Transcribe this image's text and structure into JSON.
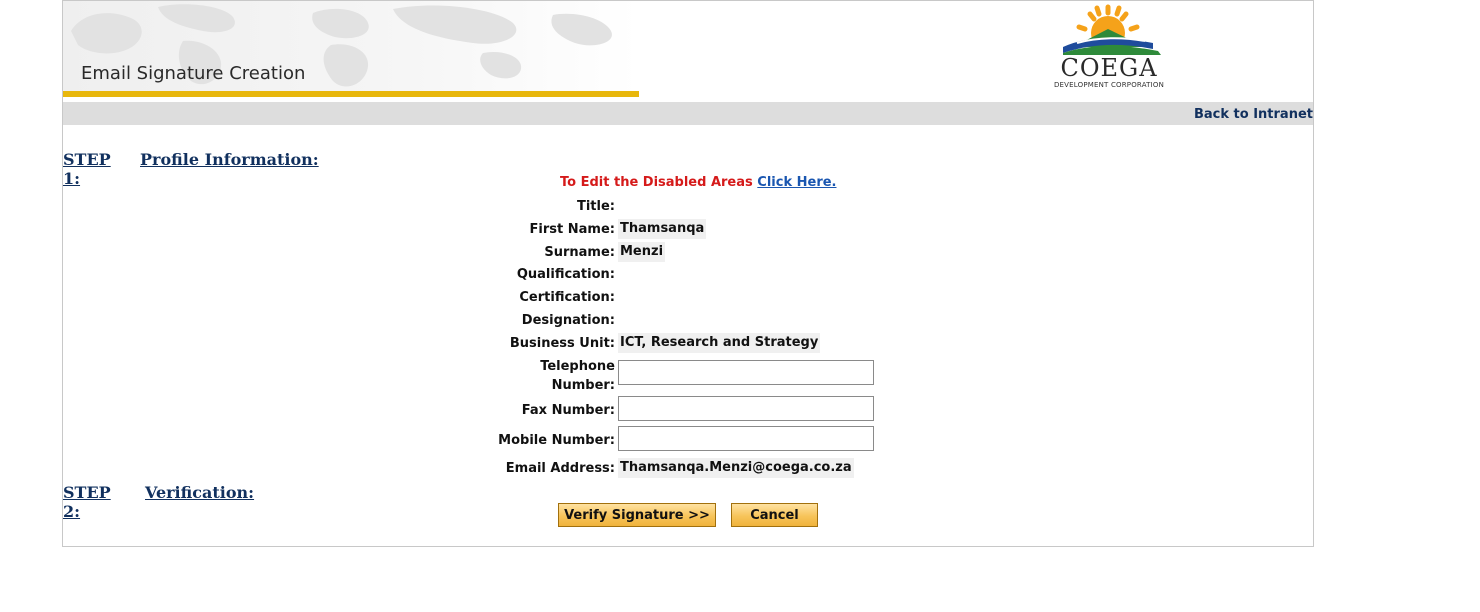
{
  "header": {
    "title": "Email Signature Creation",
    "logo_word": "COEGA",
    "logo_sub": "DEVELOPMENT CORPORATION",
    "back_link": "Back to Intranet"
  },
  "step1": {
    "number": "STEP 1:",
    "title": "Profile Information:"
  },
  "notice": {
    "text": "To Edit the Disabled Areas ",
    "link": "Click Here."
  },
  "fields": {
    "title_label": "Title:",
    "title_value": "",
    "first_name_label": "First Name:",
    "first_name_value": "Thamsanqa",
    "surname_label": "Surname:",
    "surname_value": "Menzi",
    "qualification_label": "Qualification:",
    "qualification_value": "",
    "certification_label": "Certification:",
    "certification_value": "",
    "designation_label": "Designation:",
    "designation_value": "",
    "business_unit_label": "Business Unit:",
    "business_unit_value": "ICT, Research and Strategy",
    "telephone_label_line1": "Telephone",
    "telephone_label_line2": "Number:",
    "telephone_value": "",
    "fax_label": "Fax Number:",
    "fax_value": "",
    "mobile_label": "Mobile Number:",
    "mobile_value": "",
    "email_label": "Email Address:",
    "email_value": "Thamsanqa.Menzi@coega.co.za"
  },
  "step2": {
    "number": "STEP 2:",
    "title": "Verification:"
  },
  "buttons": {
    "verify": "Verify Signature >>",
    "cancel": "Cancel"
  },
  "colors": {
    "accent_gold": "#e8b70c",
    "nav_blue": "#11305e",
    "notice_red": "#d51a1a",
    "link_blue": "#1a56b0",
    "button_fill": "#f7c45a"
  }
}
